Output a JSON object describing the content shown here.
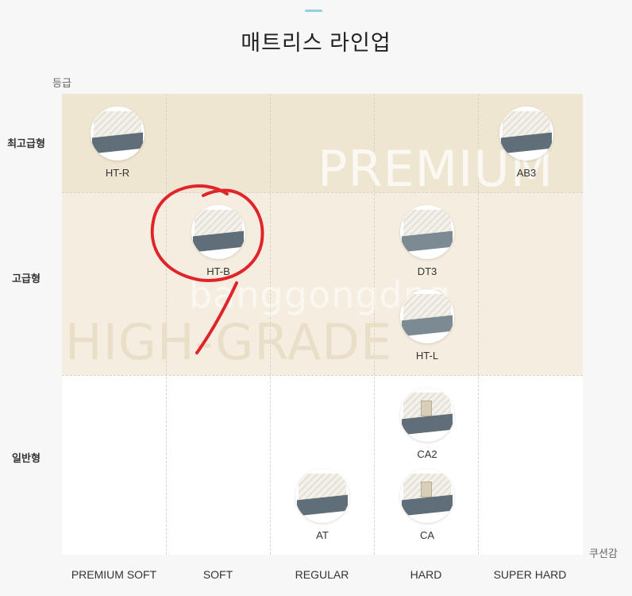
{
  "page": {
    "title": "매트리스 라인업",
    "y_axis_title": "등급",
    "x_axis_title": "쿠션감"
  },
  "rows": [
    "최고급형",
    "고급형",
    "일반형"
  ],
  "columns": [
    "PREMIUM SOFT",
    "SOFT",
    "REGULAR",
    "HARD",
    "SUPER HARD"
  ],
  "watermarks": {
    "premium": "PREMIUM",
    "high": "HIGH-GRADE",
    "site": "banggongdng"
  },
  "products": [
    {
      "name": "HT-R",
      "grade": "최고급형",
      "firmness": "PREMIUM SOFT"
    },
    {
      "name": "AB3",
      "grade": "최고급형",
      "firmness": "SUPER HARD"
    },
    {
      "name": "HT-B",
      "grade": "고급형",
      "firmness": "SOFT",
      "highlighted": true
    },
    {
      "name": "DT3",
      "grade": "고급형",
      "firmness": "HARD"
    },
    {
      "name": "HT-L",
      "grade": "고급형",
      "firmness": "HARD"
    },
    {
      "name": "CA2",
      "grade": "일반형",
      "firmness": "HARD"
    },
    {
      "name": "AT",
      "grade": "일반형",
      "firmness": "REGULAR"
    },
    {
      "name": "CA",
      "grade": "일반형",
      "firmness": "HARD"
    }
  ],
  "colors": {
    "premium_band": "#efe6d2",
    "high_band": "#f5eee0",
    "general_band": "#ffffff",
    "accent": "#8fd3e3",
    "annotation": "#e0242a"
  }
}
